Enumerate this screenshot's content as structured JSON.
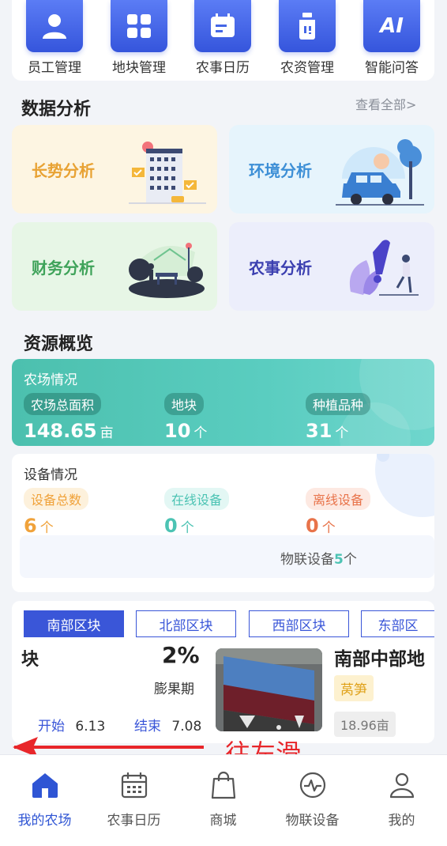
{
  "shortcuts": [
    {
      "label": "员工管理",
      "icon": "person-icon"
    },
    {
      "label": "地块管理",
      "icon": "grid-icon"
    },
    {
      "label": "农事日历",
      "icon": "calendar-icon"
    },
    {
      "label": "农资管理",
      "icon": "bottle-icon"
    },
    {
      "label": "智能问答",
      "icon": "ai-icon",
      "icon_text": "AI"
    }
  ],
  "analysis": {
    "title": "数据分析",
    "view_all": "查看全部>",
    "cards": [
      {
        "label": "长势分析",
        "color": "#e8a233",
        "bg": "#fdf5e2"
      },
      {
        "label": "环境分析",
        "color": "#3d8fd6",
        "bg": "#e6f4fc"
      },
      {
        "label": "财务分析",
        "color": "#3fa35a",
        "bg": "#e7f6e6"
      },
      {
        "label": "农事分析",
        "color": "#3b3fb0",
        "bg": "#eceefb"
      }
    ]
  },
  "resources": {
    "title": "资源概览",
    "farm": {
      "heading": "农场情况",
      "items": [
        {
          "label": "农场总面积",
          "value": "148.65",
          "unit": "亩"
        },
        {
          "label": "地块",
          "value": "10",
          "unit": "个"
        },
        {
          "label": "种植品种",
          "value": "31",
          "unit": "个"
        }
      ]
    },
    "devices": {
      "heading": "设备情况",
      "items": [
        {
          "label": "设备总数",
          "value": "6",
          "unit": "个",
          "color": "#f0a23a",
          "pill_bg": "#fdf1dc"
        },
        {
          "label": "在线设备",
          "value": "0",
          "unit": "个",
          "color": "#4cc3b3",
          "pill_bg": "#e3f7f4"
        },
        {
          "label": "离线设备",
          "value": "0",
          "unit": "个",
          "color": "#e8734a",
          "pill_bg": "#fde9e2"
        }
      ],
      "iot_prefix": "物联设备",
      "iot_count": "5",
      "iot_suffix": "个"
    }
  },
  "blocks": {
    "tabs": [
      "南部区块",
      "北部区块",
      "西部区块",
      "东部区"
    ],
    "active_tab": 0,
    "detail": {
      "left_fragment": "块",
      "percent": "2%",
      "stage": "膨果期",
      "start_label": "开始",
      "start_date": "6.13",
      "end_label": "结束",
      "end_date": "7.08",
      "plot_name": "南部中部地",
      "crop_tag": "莴笋",
      "area": "18.96亩"
    }
  },
  "swipe_hint": "往左滑",
  "nav": {
    "items": [
      {
        "label": "我的农场",
        "icon": "home-icon"
      },
      {
        "label": "农事日历",
        "icon": "calendar-icon"
      },
      {
        "label": "商城",
        "icon": "shopping-bag-icon"
      },
      {
        "label": "物联设备",
        "icon": "pulse-icon"
      },
      {
        "label": "我的",
        "icon": "user-icon"
      }
    ],
    "active": 0
  },
  "colors": {
    "primary": "#3a56d8",
    "teal": "#4cc0ae",
    "annotation_red": "#e8262a"
  }
}
